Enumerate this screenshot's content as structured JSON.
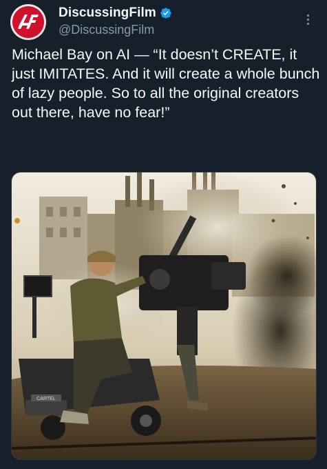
{
  "author": {
    "display_name": "DiscussingFilm",
    "handle": "@DiscussingFilm",
    "verified": true,
    "avatar_icon": "discussingfilm-logo-icon",
    "avatar_color": "#c8102e",
    "avatar_logo_text": "DF"
  },
  "tweet": {
    "text": "Michael Bay on AI — “It doesn’t CREATE, it just IMITATES. And it will create a whole bunch of lazy people. So to all the original creators out there, have no fear!”"
  },
  "media": {
    "type": "photo",
    "camera_label": "CARTEL"
  },
  "colors": {
    "background": "#15202b",
    "text": "#f7f9f9",
    "secondary_text": "#8b98a5",
    "verified": "#1d9bf0"
  },
  "icons": {
    "verified": "verified-badge-icon",
    "more": "more-options-icon"
  }
}
